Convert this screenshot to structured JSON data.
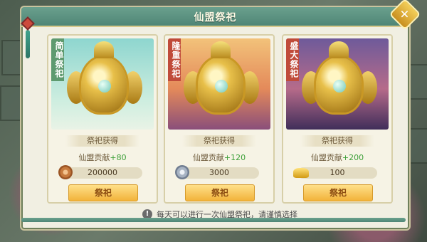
{
  "dialog": {
    "title": "仙盟祭祀",
    "close_icon": "close-icon",
    "notice": "每天可以进行一次仙盟祭祀，请谨慎选择",
    "notice_icon": "exclamation-icon"
  },
  "cards": [
    {
      "tag": "简单祭祀",
      "reward_title": "祭祀获得",
      "contrib_label": "仙盟贡献",
      "contrib_plus": "+80",
      "cost_icon": "copper-coin-icon",
      "cost_value": "200000",
      "button": "祭祀"
    },
    {
      "tag": "隆重祭祀",
      "reward_title": "祭祀获得",
      "contrib_label": "仙盟贡献",
      "contrib_plus": "+120",
      "cost_icon": "silver-coin-icon",
      "cost_value": "3000",
      "button": "祭祀"
    },
    {
      "tag": "盛大祭祀",
      "reward_title": "祭祀获得",
      "contrib_label": "仙盟贡献",
      "contrib_plus": "+200",
      "cost_icon": "gold-ingot-icon",
      "cost_value": "100",
      "button": "祭祀"
    }
  ],
  "colors": {
    "titlebar": "#5b907f",
    "button": "#f2b33a",
    "plus_green": "#3fa03a"
  }
}
